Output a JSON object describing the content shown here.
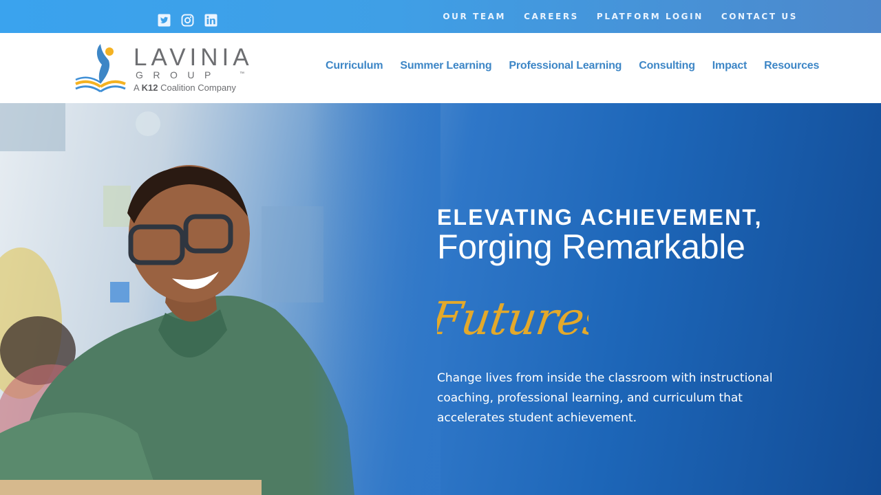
{
  "topbar": {
    "social": [
      "twitter-icon",
      "instagram-icon",
      "linkedin-icon"
    ],
    "links": [
      "OUR TEAM",
      "CAREERS",
      "PLATFORM LOGIN",
      "CONTACT US"
    ]
  },
  "logo": {
    "wordmark": "LAVINIA",
    "group": "GROUP",
    "trademark": "™",
    "tagline_prefix": "A",
    "tagline_brand": "K12",
    "tagline_suffix": "Coalition Company"
  },
  "nav": {
    "items": [
      "Curriculum",
      "Summer Learning",
      "Professional Learning",
      "Consulting",
      "Impact",
      "Resources"
    ]
  },
  "hero": {
    "eyebrow": "ELEVATING ACHIEVEMENT,",
    "headline": "Forging Remarkable",
    "script_word": "Futures",
    "lede": "Change lives from inside the classroom with instructional coaching, professional learning, and curriculum that accelerates student achievement."
  },
  "colors": {
    "topbar": "#3aa3ee",
    "nav_link": "#3d86c6",
    "hero_blue": "#1d66b8",
    "script_gold": "#e3a92b",
    "logo_gray": "#6d6e71"
  }
}
